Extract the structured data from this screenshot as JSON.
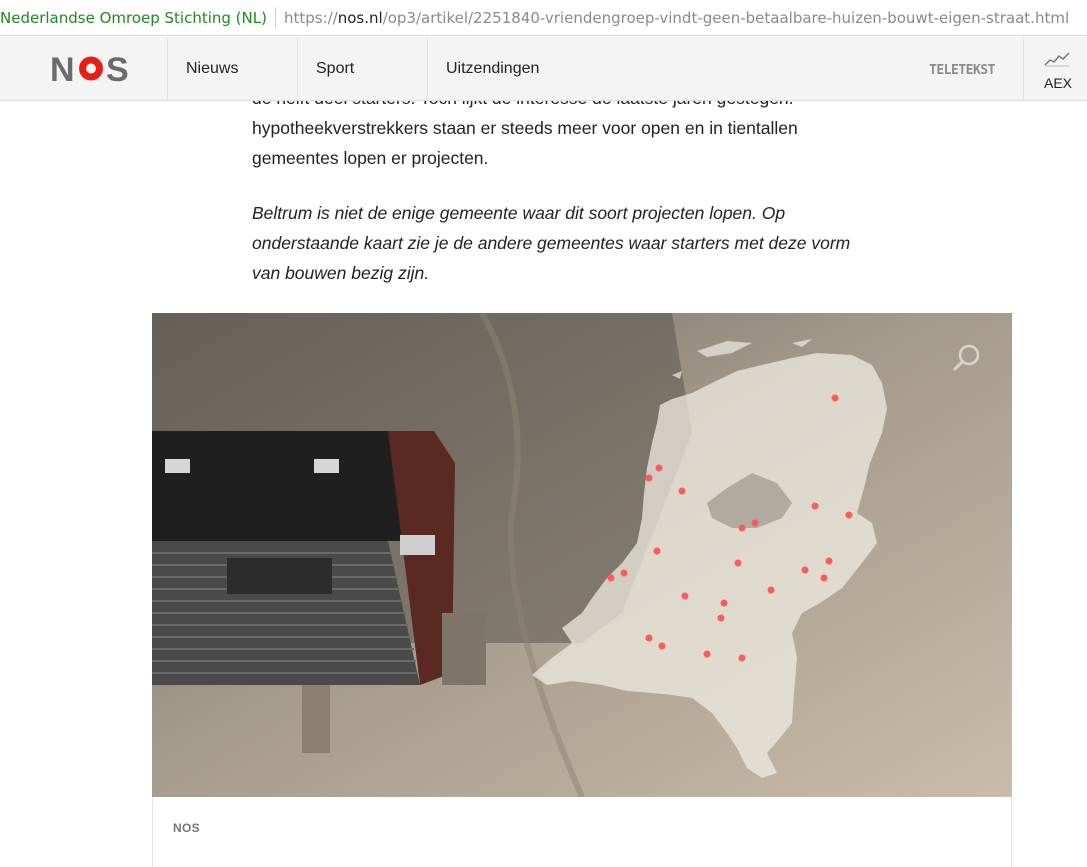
{
  "browser": {
    "identity": "Nederlandse Omroep Stichting (NL)",
    "url_scheme": "https://",
    "url_host": "nos.nl",
    "url_path": "/op3/artikel/2251840-vriendengroep-vindt-geen-betaalbare-huizen-bouwt-eigen-straat.html"
  },
  "header": {
    "logo": "NOS",
    "nav": [
      "Nieuws",
      "Sport",
      "Uitzendingen"
    ],
    "teletekst": "TELETEKST",
    "aex": "AEX"
  },
  "article": {
    "para1_lines": [
      "de helft deel starters. Toch lijkt de interesse de laatste jaren gestegen.",
      "hypotheekverstrekkers staan er steeds meer voor open en in tientallen",
      "gemeentes lopen er projecten."
    ],
    "para2_lines": [
      "Beltrum is niet de enige gemeente waar dit soort projecten lopen. Op",
      "onderstaande kaart zie je de andere gemeentes waar starters met deze vorm",
      "van bouwen bezig zijn."
    ]
  },
  "map": {
    "caption": "NOS",
    "dot_color": "#ff5a5a"
  }
}
